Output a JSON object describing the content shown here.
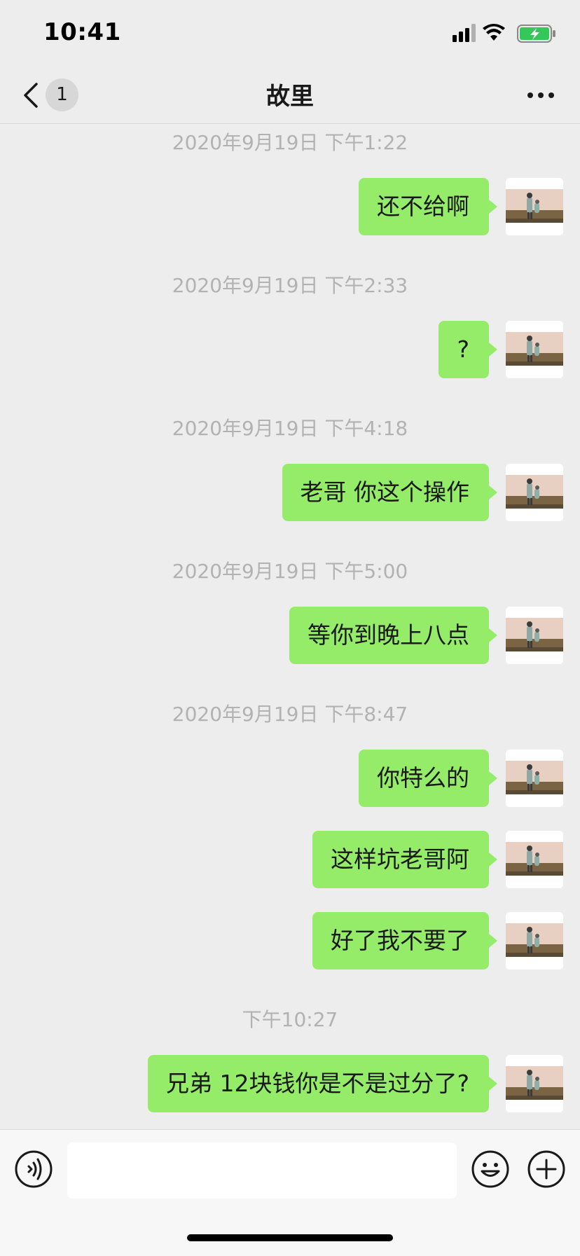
{
  "status_bar": {
    "time": "10:41",
    "icons": [
      "cellular-signal-icon",
      "wifi-icon",
      "battery-charging-icon"
    ],
    "battery_color": "#34c759"
  },
  "nav": {
    "back_icon": "chevron-left-icon",
    "unread_count": "1",
    "title": "故里",
    "more_icon": "more-icon"
  },
  "colors": {
    "background": "#ededed",
    "bubble_outgoing": "#95ec69",
    "timestamp": "#b2b2b2"
  },
  "messages": [
    {
      "time": "2020年9月19日 下午1:22",
      "text": "还不给啊"
    },
    {
      "time": "2020年9月19日 下午2:33",
      "text": "?"
    },
    {
      "time": "2020年9月19日 下午4:18",
      "text": "老哥 你这个操作"
    },
    {
      "time": "2020年9月19日 下午5:00",
      "text": "等你到晚上八点"
    },
    {
      "time": "2020年9月19日 下午8:47",
      "text": "你特么的"
    },
    {
      "text": "这样坑老哥阿"
    },
    {
      "text": "好了我不要了"
    },
    {
      "time": "下午10:27",
      "text": "兄弟 12块钱你是不是过分了?"
    }
  ],
  "input_bar": {
    "voice_icon": "voice-icon",
    "input_value": "",
    "emoji_icon": "emoji-icon",
    "plus_icon": "plus-icon"
  }
}
